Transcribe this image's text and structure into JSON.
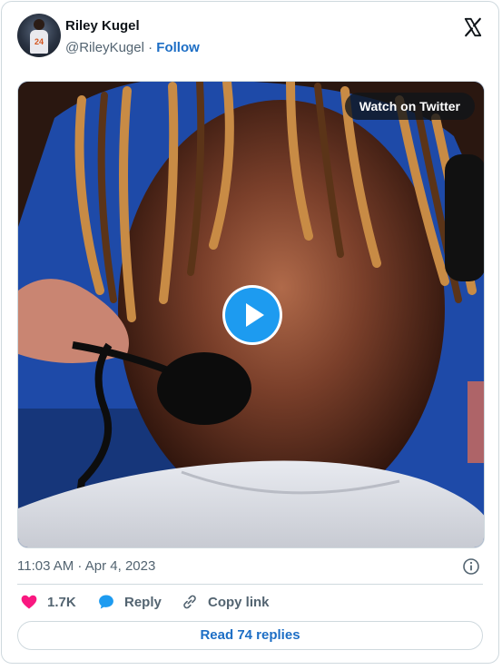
{
  "author": {
    "display_name": "Riley Kugel",
    "handle": "@RileyKugel",
    "separator": "·",
    "follow_label": "Follow",
    "avatar_jersey_number": "24"
  },
  "media": {
    "watch_label": "Watch on Twitter",
    "play_icon": "play-icon"
  },
  "tweet": {
    "timestamp": "11:03 AM · Apr 4, 2023"
  },
  "actions": {
    "like_count": "1.7K",
    "reply_label": "Reply",
    "copy_link_label": "Copy link"
  },
  "footer": {
    "read_replies_label": "Read 74 replies"
  },
  "colors": {
    "accent": "#1d9bf0",
    "link": "#1d6ec5",
    "like": "#f91880",
    "text_primary": "#0f1419",
    "text_secondary": "#536471",
    "border": "#cfd9de"
  }
}
